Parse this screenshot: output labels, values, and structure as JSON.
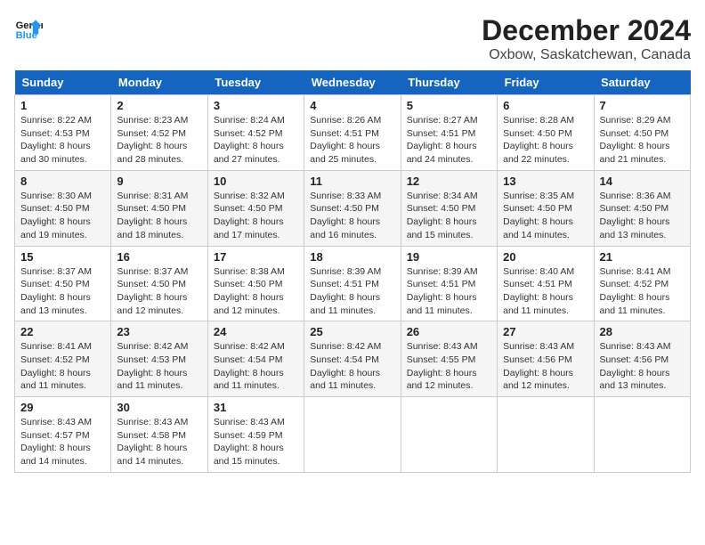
{
  "logo": {
    "line1": "General",
    "line2": "Blue"
  },
  "title": "December 2024",
  "subtitle": "Oxbow, Saskatchewan, Canada",
  "days_of_week": [
    "Sunday",
    "Monday",
    "Tuesday",
    "Wednesday",
    "Thursday",
    "Friday",
    "Saturday"
  ],
  "weeks": [
    [
      {
        "day": 1,
        "detail": "Sunrise: 8:22 AM\nSunset: 4:53 PM\nDaylight: 8 hours\nand 30 minutes."
      },
      {
        "day": 2,
        "detail": "Sunrise: 8:23 AM\nSunset: 4:52 PM\nDaylight: 8 hours\nand 28 minutes."
      },
      {
        "day": 3,
        "detail": "Sunrise: 8:24 AM\nSunset: 4:52 PM\nDaylight: 8 hours\nand 27 minutes."
      },
      {
        "day": 4,
        "detail": "Sunrise: 8:26 AM\nSunset: 4:51 PM\nDaylight: 8 hours\nand 25 minutes."
      },
      {
        "day": 5,
        "detail": "Sunrise: 8:27 AM\nSunset: 4:51 PM\nDaylight: 8 hours\nand 24 minutes."
      },
      {
        "day": 6,
        "detail": "Sunrise: 8:28 AM\nSunset: 4:50 PM\nDaylight: 8 hours\nand 22 minutes."
      },
      {
        "day": 7,
        "detail": "Sunrise: 8:29 AM\nSunset: 4:50 PM\nDaylight: 8 hours\nand 21 minutes."
      }
    ],
    [
      {
        "day": 8,
        "detail": "Sunrise: 8:30 AM\nSunset: 4:50 PM\nDaylight: 8 hours\nand 19 minutes."
      },
      {
        "day": 9,
        "detail": "Sunrise: 8:31 AM\nSunset: 4:50 PM\nDaylight: 8 hours\nand 18 minutes."
      },
      {
        "day": 10,
        "detail": "Sunrise: 8:32 AM\nSunset: 4:50 PM\nDaylight: 8 hours\nand 17 minutes."
      },
      {
        "day": 11,
        "detail": "Sunrise: 8:33 AM\nSunset: 4:50 PM\nDaylight: 8 hours\nand 16 minutes."
      },
      {
        "day": 12,
        "detail": "Sunrise: 8:34 AM\nSunset: 4:50 PM\nDaylight: 8 hours\nand 15 minutes."
      },
      {
        "day": 13,
        "detail": "Sunrise: 8:35 AM\nSunset: 4:50 PM\nDaylight: 8 hours\nand 14 minutes."
      },
      {
        "day": 14,
        "detail": "Sunrise: 8:36 AM\nSunset: 4:50 PM\nDaylight: 8 hours\nand 13 minutes."
      }
    ],
    [
      {
        "day": 15,
        "detail": "Sunrise: 8:37 AM\nSunset: 4:50 PM\nDaylight: 8 hours\nand 13 minutes."
      },
      {
        "day": 16,
        "detail": "Sunrise: 8:37 AM\nSunset: 4:50 PM\nDaylight: 8 hours\nand 12 minutes."
      },
      {
        "day": 17,
        "detail": "Sunrise: 8:38 AM\nSunset: 4:50 PM\nDaylight: 8 hours\nand 12 minutes."
      },
      {
        "day": 18,
        "detail": "Sunrise: 8:39 AM\nSunset: 4:51 PM\nDaylight: 8 hours\nand 11 minutes."
      },
      {
        "day": 19,
        "detail": "Sunrise: 8:39 AM\nSunset: 4:51 PM\nDaylight: 8 hours\nand 11 minutes."
      },
      {
        "day": 20,
        "detail": "Sunrise: 8:40 AM\nSunset: 4:51 PM\nDaylight: 8 hours\nand 11 minutes."
      },
      {
        "day": 21,
        "detail": "Sunrise: 8:41 AM\nSunset: 4:52 PM\nDaylight: 8 hours\nand 11 minutes."
      }
    ],
    [
      {
        "day": 22,
        "detail": "Sunrise: 8:41 AM\nSunset: 4:52 PM\nDaylight: 8 hours\nand 11 minutes."
      },
      {
        "day": 23,
        "detail": "Sunrise: 8:42 AM\nSunset: 4:53 PM\nDaylight: 8 hours\nand 11 minutes."
      },
      {
        "day": 24,
        "detail": "Sunrise: 8:42 AM\nSunset: 4:54 PM\nDaylight: 8 hours\nand 11 minutes."
      },
      {
        "day": 25,
        "detail": "Sunrise: 8:42 AM\nSunset: 4:54 PM\nDaylight: 8 hours\nand 11 minutes."
      },
      {
        "day": 26,
        "detail": "Sunrise: 8:43 AM\nSunset: 4:55 PM\nDaylight: 8 hours\nand 12 minutes."
      },
      {
        "day": 27,
        "detail": "Sunrise: 8:43 AM\nSunset: 4:56 PM\nDaylight: 8 hours\nand 12 minutes."
      },
      {
        "day": 28,
        "detail": "Sunrise: 8:43 AM\nSunset: 4:56 PM\nDaylight: 8 hours\nand 13 minutes."
      }
    ],
    [
      {
        "day": 29,
        "detail": "Sunrise: 8:43 AM\nSunset: 4:57 PM\nDaylight: 8 hours\nand 14 minutes."
      },
      {
        "day": 30,
        "detail": "Sunrise: 8:43 AM\nSunset: 4:58 PM\nDaylight: 8 hours\nand 14 minutes."
      },
      {
        "day": 31,
        "detail": "Sunrise: 8:43 AM\nSunset: 4:59 PM\nDaylight: 8 hours\nand 15 minutes."
      },
      null,
      null,
      null,
      null
    ]
  ]
}
